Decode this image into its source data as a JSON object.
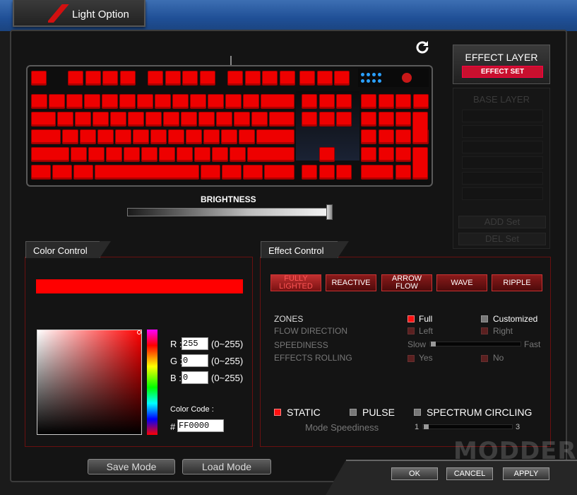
{
  "window": {
    "tab_title": "Light Option"
  },
  "icons": {
    "refresh": "refresh-icon"
  },
  "colors": {
    "accent": "#ff0000",
    "effect_set": "#c8102e"
  },
  "keyboard": {
    "brightness_label": "BRIGHTNESS",
    "brightness_level": 1.0
  },
  "layers": {
    "effect_layer": "EFFECT LAYER",
    "effect_set": "EFFECT SET",
    "base_layer": "BASE LAYER",
    "add_set": "ADD Set",
    "del_set": "DEL Set"
  },
  "color_control": {
    "title": "Color Control",
    "current_color": "#FF0000",
    "r_label": "R :",
    "r_value": "255",
    "r_range": "(0~255)",
    "g_label": "G :",
    "g_value": "0",
    "g_range": "(0~255)",
    "b_label": "B :",
    "b_value": "0",
    "b_range": "(0~255)",
    "code_label": "Color Code :",
    "hash": "#",
    "code_value": "FF0000"
  },
  "effect_control": {
    "title": "Effect Control",
    "buttons": [
      "FULLY LIGHTED",
      "REACTIVE",
      "ARROW FLOW",
      "WAVE",
      "RIPPLE"
    ],
    "selected_effect": "FULLY LIGHTED",
    "zones_label": "ZONES",
    "zones_full": "Full",
    "zones_customized": "Customized",
    "flow_label": "FLOW DIRECTION",
    "flow_left": "Left",
    "flow_right": "Right",
    "speed_label": "SPEEDINESS",
    "speed_slow": "Slow",
    "speed_fast": "Fast",
    "rolling_label": "EFFECTS ROLLING",
    "rolling_yes": "Yes",
    "rolling_no": "No",
    "mode_static": "STATIC",
    "mode_pulse": "PULSE",
    "mode_spectrum": "SPECTRUM CIRCLING",
    "mode_speed_label": "Mode Speediness",
    "mode_speed_min": "1",
    "mode_speed_max": "3"
  },
  "footer": {
    "save_mode": "Save Mode",
    "load_mode": "Load Mode",
    "ok": "OK",
    "cancel": "CANCEL",
    "apply": "APPLY",
    "watermark": "MODDERS"
  }
}
